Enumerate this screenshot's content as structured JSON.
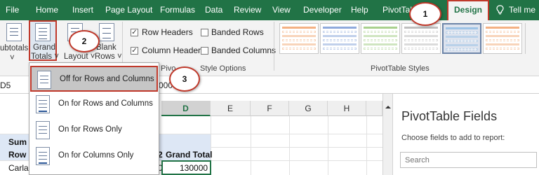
{
  "ribbon_tabs": {
    "file": "File",
    "home": "Home",
    "insert": "Insert",
    "page_layout": "Page Layout",
    "formulas": "Formulas",
    "data": "Data",
    "review": "Review",
    "view": "View",
    "developer": "Developer",
    "help": "Help",
    "pivottable_analyze": "PivotTab",
    "design": "Design",
    "tell_me": "Tell me"
  },
  "layout_group": {
    "subtotals": "ubtotals",
    "subtotals_arrow": "˅",
    "grand_totals_line1": "Grand",
    "grand_totals_line2": "Totals ˅",
    "report_layout_line1": "R",
    "report_layout_line2": "Layout ˅",
    "blank_rows_line1": "Blank",
    "blank_rows_line2": "Rows ˅"
  },
  "style_options": {
    "row_headers": "Row Headers",
    "row_headers_checked": true,
    "banded_rows": "Banded Rows",
    "banded_rows_checked": false,
    "column_headers": "Column Headers",
    "column_headers_checked": true,
    "banded_columns": "Banded Columns",
    "banded_columns_checked": false,
    "caption_left": "Pivo",
    "caption_right": "Style Options"
  },
  "styles_gallery": {
    "caption": "PivotTable Styles",
    "colors": [
      "#f4b183",
      "#8faadc",
      "#a9d18e",
      "#bfbfbf",
      "#9dc3e6",
      "#f4b183"
    ]
  },
  "formula_bar": {
    "name_box": "D5",
    "value_fragment": "0000"
  },
  "grid": {
    "columns": [
      "D",
      "E",
      "F",
      "G",
      "H"
    ],
    "selected_column": "D",
    "cells": {
      "sum_of": "Sum o",
      "row_labels": "Row L",
      "carla": "Carla",
      "col_c_fragment": "2",
      "grand_total": "Grand Total",
      "value_130000": "130000",
      "col_c_value": "0"
    }
  },
  "grand_totals_menu": {
    "items": [
      {
        "label": "Off for Rows and Columns",
        "highlighted": true
      },
      {
        "label": "On for Rows and Columns",
        "highlighted": false
      },
      {
        "label": "On for Rows Only",
        "highlighted": false
      },
      {
        "label": "On for Columns Only",
        "highlighted": false
      }
    ]
  },
  "task_pane": {
    "title": "PivotTable Fields",
    "subtitle": "Choose fields to add to report:",
    "search_placeholder": "Search"
  },
  "callouts": [
    "1",
    "2",
    "3"
  ],
  "colors": {
    "excel_green": "#217346",
    "callout_red": "#c0392b",
    "header_fill": "#dde7f5"
  }
}
